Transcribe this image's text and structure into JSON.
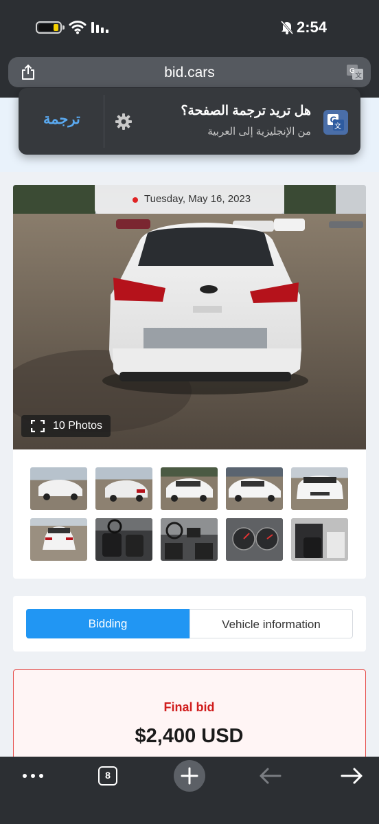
{
  "status_bar": {
    "time": "2:54"
  },
  "browser": {
    "url": "bid.cars",
    "tab_count": "8"
  },
  "translate_banner": {
    "question": "هل تريد ترجمة الصفحة؟",
    "languages": "من الإنجليزية إلى العربية",
    "action_label": "ترجمة"
  },
  "gallery": {
    "date": "Tuesday, May 16, 2023",
    "photos_label": "10 Photos",
    "thumbnails": [
      {
        "alt": "front-left view"
      },
      {
        "alt": "rear-right view"
      },
      {
        "alt": "left side view"
      },
      {
        "alt": "right side view"
      },
      {
        "alt": "front view"
      },
      {
        "alt": "rear view"
      },
      {
        "alt": "front interior"
      },
      {
        "alt": "dashboard"
      },
      {
        "alt": "instrument cluster"
      },
      {
        "alt": "rear interior"
      }
    ]
  },
  "tabs": {
    "bidding": "Bidding",
    "vehicle_info": "Vehicle information"
  },
  "bid": {
    "label": "Final bid",
    "amount": "$2,400 USD"
  },
  "colors": {
    "accent": "#2196f3",
    "bid_red": "#d01c1c",
    "translate_link": "#5aa9f0"
  }
}
